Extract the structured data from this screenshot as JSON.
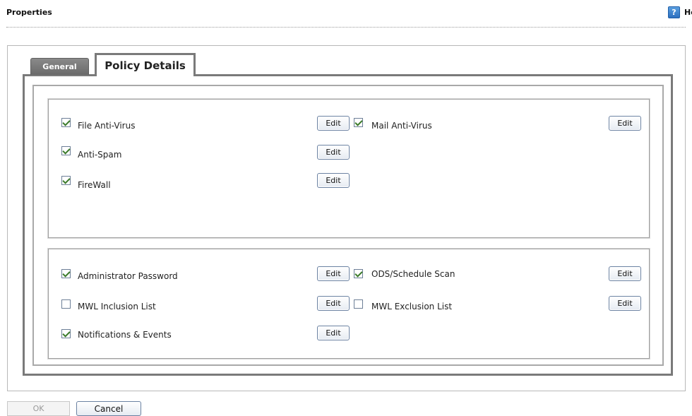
{
  "header": {
    "title": "Properties",
    "help_label": "Help",
    "help_icon": "help-icon"
  },
  "tabs": [
    {
      "label": "General",
      "active": false
    },
    {
      "label": "Policy Details",
      "active": true
    }
  ],
  "policy_section": {
    "items": [
      {
        "label": "File Anti-Virus",
        "checked": true,
        "edit_label": "Edit"
      },
      {
        "label": "Mail Anti-Virus",
        "checked": true,
        "edit_label": "Edit"
      },
      {
        "label": "Anti-Spam",
        "checked": true,
        "edit_label": "Edit"
      },
      {
        "label": "FireWall",
        "checked": true,
        "edit_label": "Edit"
      }
    ]
  },
  "settings_section": {
    "items": [
      {
        "label": "Administrator Password",
        "checked": true,
        "edit_label": "Edit"
      },
      {
        "label": "ODS/Schedule Scan",
        "checked": true,
        "edit_label": "Edit"
      },
      {
        "label": "MWL Inclusion List",
        "checked": false,
        "edit_label": "Edit"
      },
      {
        "label": "MWL Exclusion List",
        "checked": false,
        "edit_label": "Edit"
      },
      {
        "label": "Notifications & Events",
        "checked": true,
        "edit_label": "Edit"
      }
    ]
  },
  "footer": {
    "ok_label": "OK",
    "cancel_label": "Cancel"
  },
  "colors": {
    "tab_active_border": "#7a7a7a",
    "tab_inactive_bg": "#7a7a7a",
    "button_border": "#6b82a2",
    "check_mark": "#3a7a2a"
  }
}
